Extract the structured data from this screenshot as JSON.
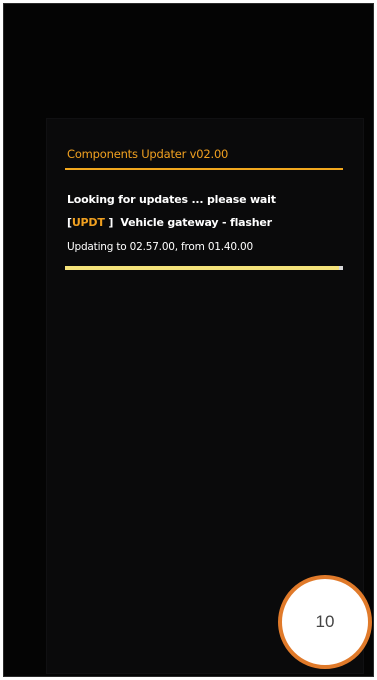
{
  "updater": {
    "title": "Components Updater v02.00",
    "status_line": "Looking for updates ... please wait",
    "tag_open": "[",
    "tag_code": "UPDT",
    "tag_close": "]",
    "component": "Vehicle gateway - flasher",
    "version_line": "Updating to 02.57.00, from 01.40.00",
    "progress_fraction": 0.99
  },
  "overlay": {
    "page_number": "10"
  },
  "colors": {
    "accent": "#f0a020",
    "progress": "#f4e27a",
    "screen_bg": "#0a0a0b",
    "badge_ring": "#e07a2a"
  }
}
